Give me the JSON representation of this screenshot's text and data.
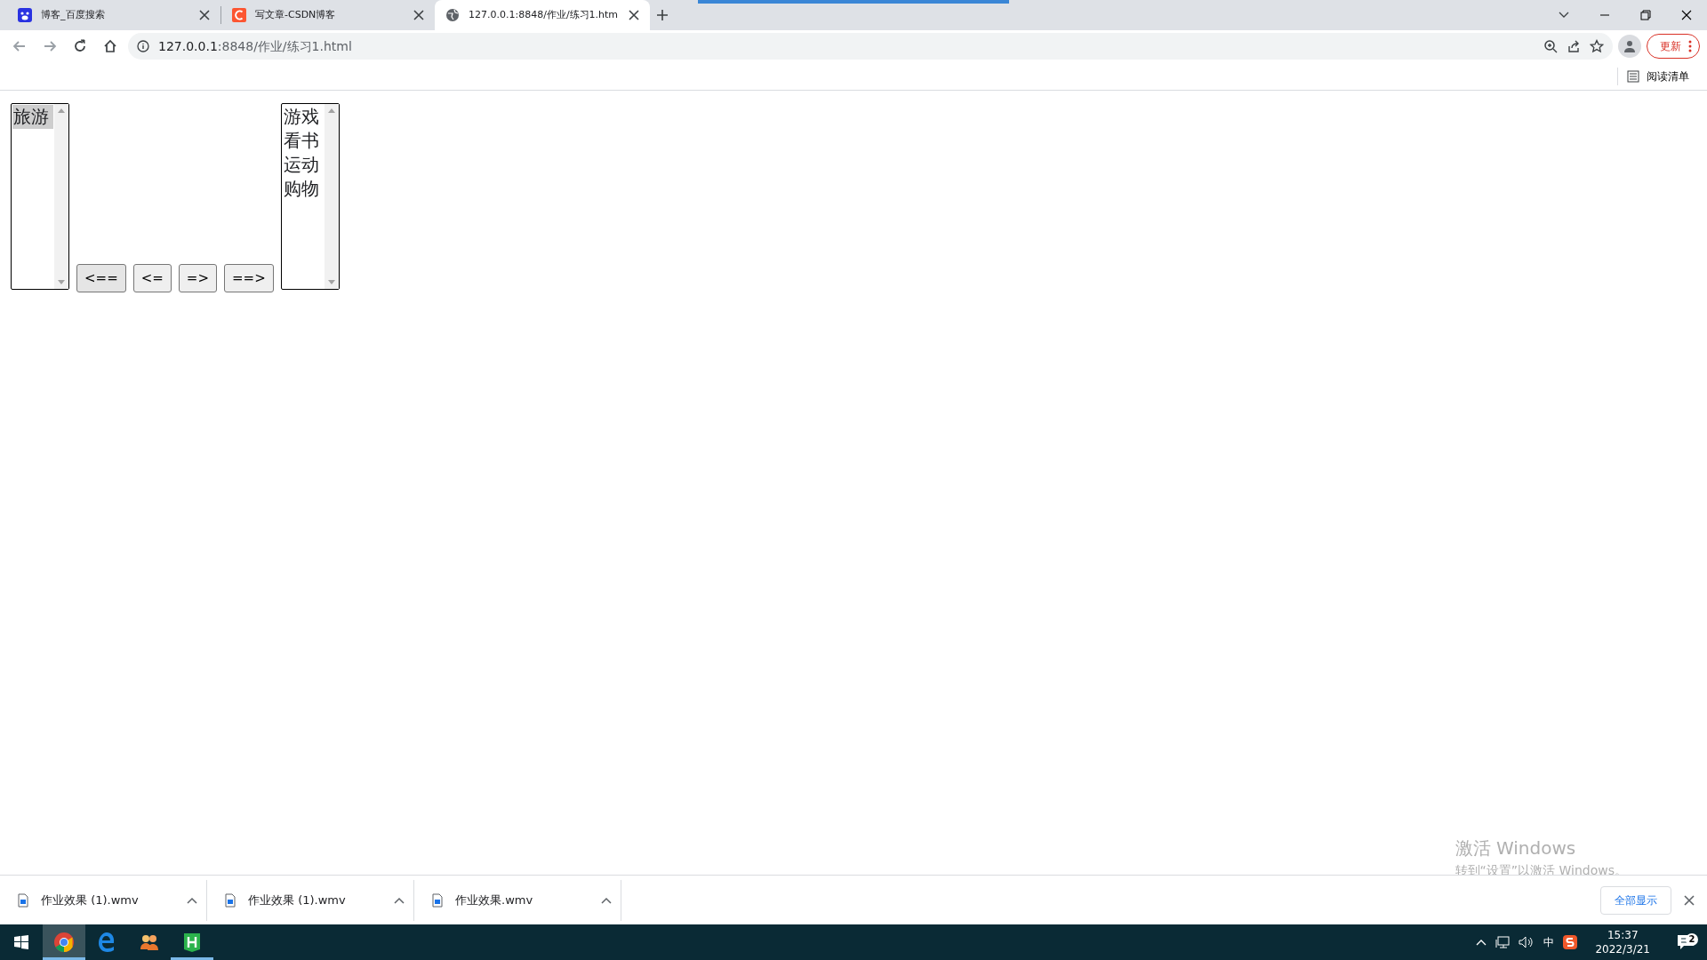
{
  "browser": {
    "tabs": [
      {
        "title": "博客_百度搜索",
        "kind": "paw",
        "selected": false
      },
      {
        "title": "写文章-CSDN博客",
        "kind": "csdn",
        "selected": false
      },
      {
        "title": "127.0.0.1:8848/作业/练习1.htm",
        "kind": "globe",
        "selected": true
      }
    ],
    "address_host": "127.0.0.1",
    "address_rest": ":8848/作业/练习1.html",
    "update_label": "更新",
    "reading_list": "阅读清单"
  },
  "page": {
    "left_list": {
      "options": [
        {
          "label": "旅游",
          "selected": true
        }
      ]
    },
    "buttons": [
      "<==",
      "<=",
      "=>",
      "==>"
    ],
    "right_list": {
      "options": [
        {
          "label": "游戏",
          "selected": false
        },
        {
          "label": "看书",
          "selected": false
        },
        {
          "label": "运动",
          "selected": false
        },
        {
          "label": "购物",
          "selected": false
        }
      ]
    }
  },
  "activation": {
    "title": "激活 Windows",
    "subtitle": "转到“设置”以激活 Windows。"
  },
  "downloads": {
    "items": [
      {
        "filename": "作业效果 (1).wmv"
      },
      {
        "filename": "作业效果 (1).wmv"
      },
      {
        "filename": "作业效果.wmv"
      }
    ],
    "show_all": "全部显示"
  },
  "taskbar": {
    "apps": [
      {
        "kind": "chrome",
        "selected": true,
        "running": true
      },
      {
        "kind": "edge",
        "selected": false,
        "running": false
      },
      {
        "kind": "people",
        "selected": false,
        "running": false
      },
      {
        "kind": "hbuilder",
        "selected": false,
        "running": true
      }
    ],
    "ime": "中",
    "time": "15:37",
    "date": "2022/3/21",
    "notifications": "2"
  }
}
